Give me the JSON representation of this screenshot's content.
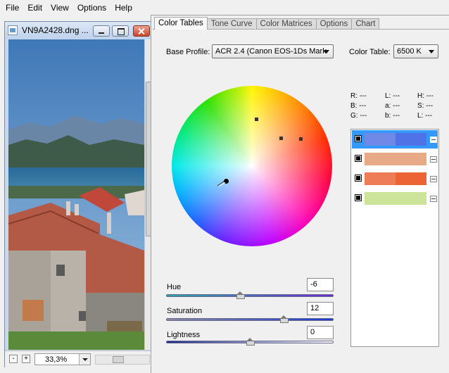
{
  "menubar": {
    "items": [
      "File",
      "Edit",
      "View",
      "Options",
      "Help"
    ]
  },
  "image_window": {
    "title": "VN9A2428.dng ...",
    "zoom": "33,3%",
    "minus_label": "-",
    "plus_label": "+"
  },
  "panel": {
    "tabs": [
      "Color Tables",
      "Tone Curve",
      "Color Matrices",
      "Options",
      "Chart"
    ],
    "active_tab": "Color Tables",
    "base_profile_label": "Base Profile:",
    "base_profile_value": "ACR 2.4 (Canon EOS-1Ds Mark",
    "color_table_label": "Color Table:",
    "color_table_value": "6500 K",
    "readout": {
      "r": "R: ---",
      "b": "B: ---",
      "g": "G: ---",
      "l1": "L: ---",
      "a": "a: ---",
      "b2": "b: ---",
      "h": "H: ---",
      "s": "S: ---",
      "l2": "L: ---"
    },
    "colors": [
      {
        "left": "#6e8ae6",
        "right": "#4f72e6",
        "selected": true
      },
      {
        "left": "#e8aa86",
        "right": "#e8aa86",
        "selected": false
      },
      {
        "left": "#ee7c56",
        "right": "#ec6334",
        "selected": false
      },
      {
        "left": "#cce49a",
        "right": "#cce49a",
        "selected": false
      }
    ],
    "sliders": {
      "hue": {
        "label": "Hue",
        "value": "-6",
        "fraction": 0.44
      },
      "saturation": {
        "label": "Saturation",
        "value": "12",
        "fraction": 0.7
      },
      "lightness": {
        "label": "Lightness",
        "value": "0",
        "fraction": 0.5
      }
    }
  },
  "colors": {
    "accent": "#3399ff",
    "hue_track_start": "#2aa6a6",
    "hue_track_end": "#6a2ad6",
    "sat_track_start": "#8a8aa0",
    "sat_track_end": "#1a3ad6",
    "light_track_start": "#1a2a8a",
    "light_track_end": "#ffffff"
  }
}
